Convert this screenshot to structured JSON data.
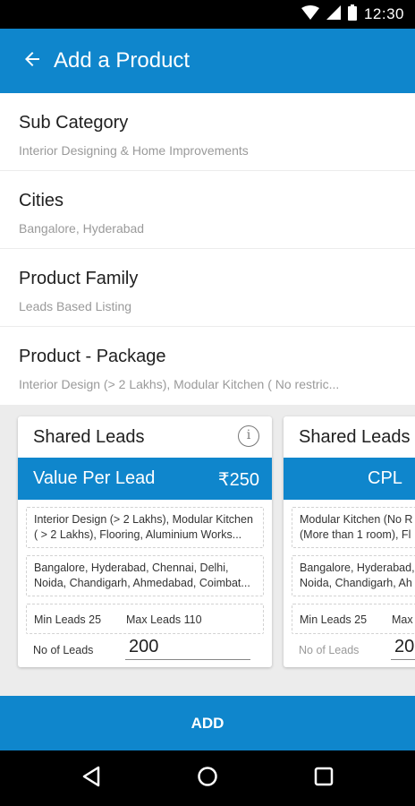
{
  "status_bar": {
    "time": "12:30"
  },
  "app_bar": {
    "title": "Add a Product"
  },
  "fields": [
    {
      "label": "Sub Category",
      "value": "Interior Designing & Home Improvements"
    },
    {
      "label": "Cities",
      "value": "Bangalore, Hyderabad"
    },
    {
      "label": "Product Family",
      "value": "Leads Based Listing"
    },
    {
      "label": "Product - Package",
      "value": "Interior Design (> 2 Lakhs), Modular Kitchen ( No restric..."
    }
  ],
  "cards": [
    {
      "title": "Shared Leads",
      "price_label": "Value Per Lead",
      "price_value": "₹250",
      "products_line1": "Interior Design (> 2 Lakhs), Modular Kitchen",
      "products_line2": "( > 2 Lakhs), Flooring, Aluminium Works...",
      "cities_line1": "Bangalore, Hyderabad, Chennai, Delhi,",
      "cities_line2": "Noida, Chandigarh, Ahmedabad, Coimbat...",
      "min_leads": "Min Leads 25",
      "max_leads": "Max Leads 110",
      "no_of_leads_label": "No of Leads",
      "no_of_leads_value": "200"
    },
    {
      "title": "Shared Leads",
      "price_label": "CPL",
      "products_line1": "Modular Kitchen (No R",
      "products_line2": "(More than 1 room), Fl",
      "cities_line1": "Bangalore, Hyderabad,",
      "cities_line2": "Noida, Chandigarh, Ah",
      "min_leads": "Min Leads 25",
      "max_leads": "Max",
      "no_of_leads_label": "No of Leads",
      "no_of_leads_value": "20"
    }
  ],
  "add_button": {
    "label": "ADD"
  },
  "colors": {
    "primary": "#0f86cc",
    "background": "#ececec",
    "text": "#202020",
    "muted": "#9a9a9a"
  },
  "icons": [
    "wifi-icon",
    "signal-icon",
    "battery-icon",
    "back-arrow-icon",
    "info-icon",
    "nav-back-icon",
    "nav-home-icon",
    "nav-recent-icon"
  ]
}
